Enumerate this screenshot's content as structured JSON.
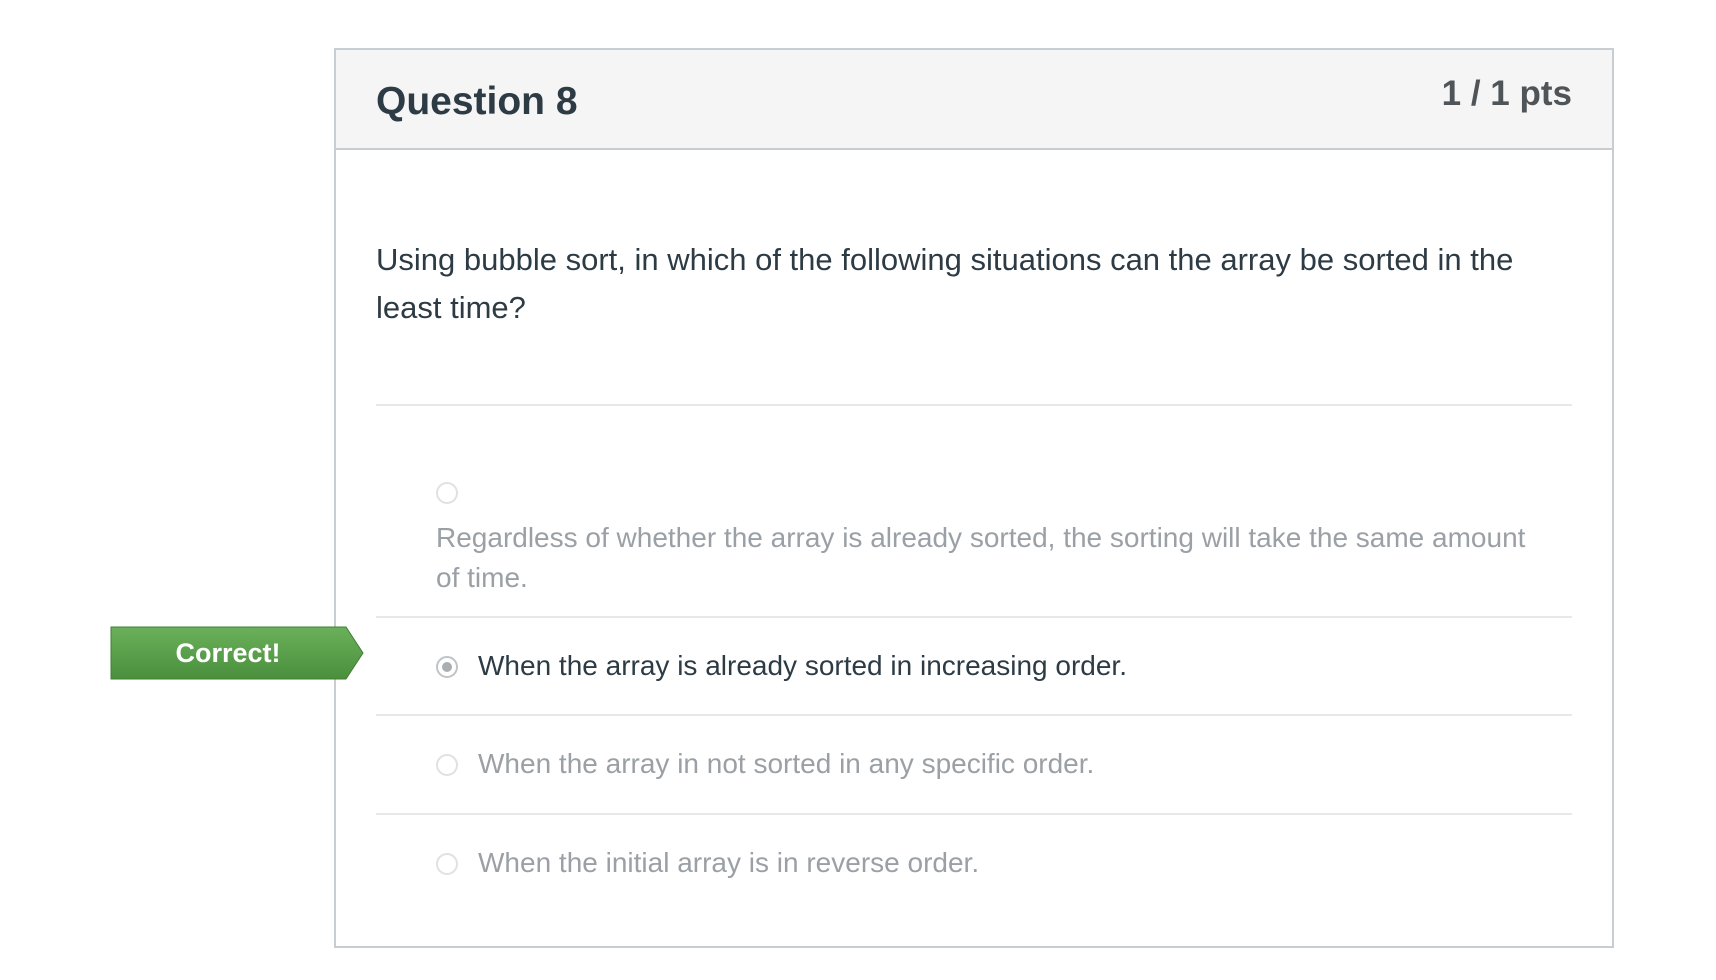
{
  "question": {
    "title": "Question 8",
    "points": "1 / 1 pts",
    "text": "Using bubble sort, in which of the following situations can the array be sorted in the least time?"
  },
  "feedback": {
    "label": "Correct!",
    "color": "#5b9e4d"
  },
  "answers": [
    {
      "text": "Regardless of whether the array is already sorted, the sorting will take the same amount of time.",
      "selected": false
    },
    {
      "text": "When the array is already sorted in increasing order.",
      "selected": true
    },
    {
      "text": "When the array in not sorted in any specific order.",
      "selected": false
    },
    {
      "text": "When the initial array is in reverse order.",
      "selected": false
    }
  ]
}
